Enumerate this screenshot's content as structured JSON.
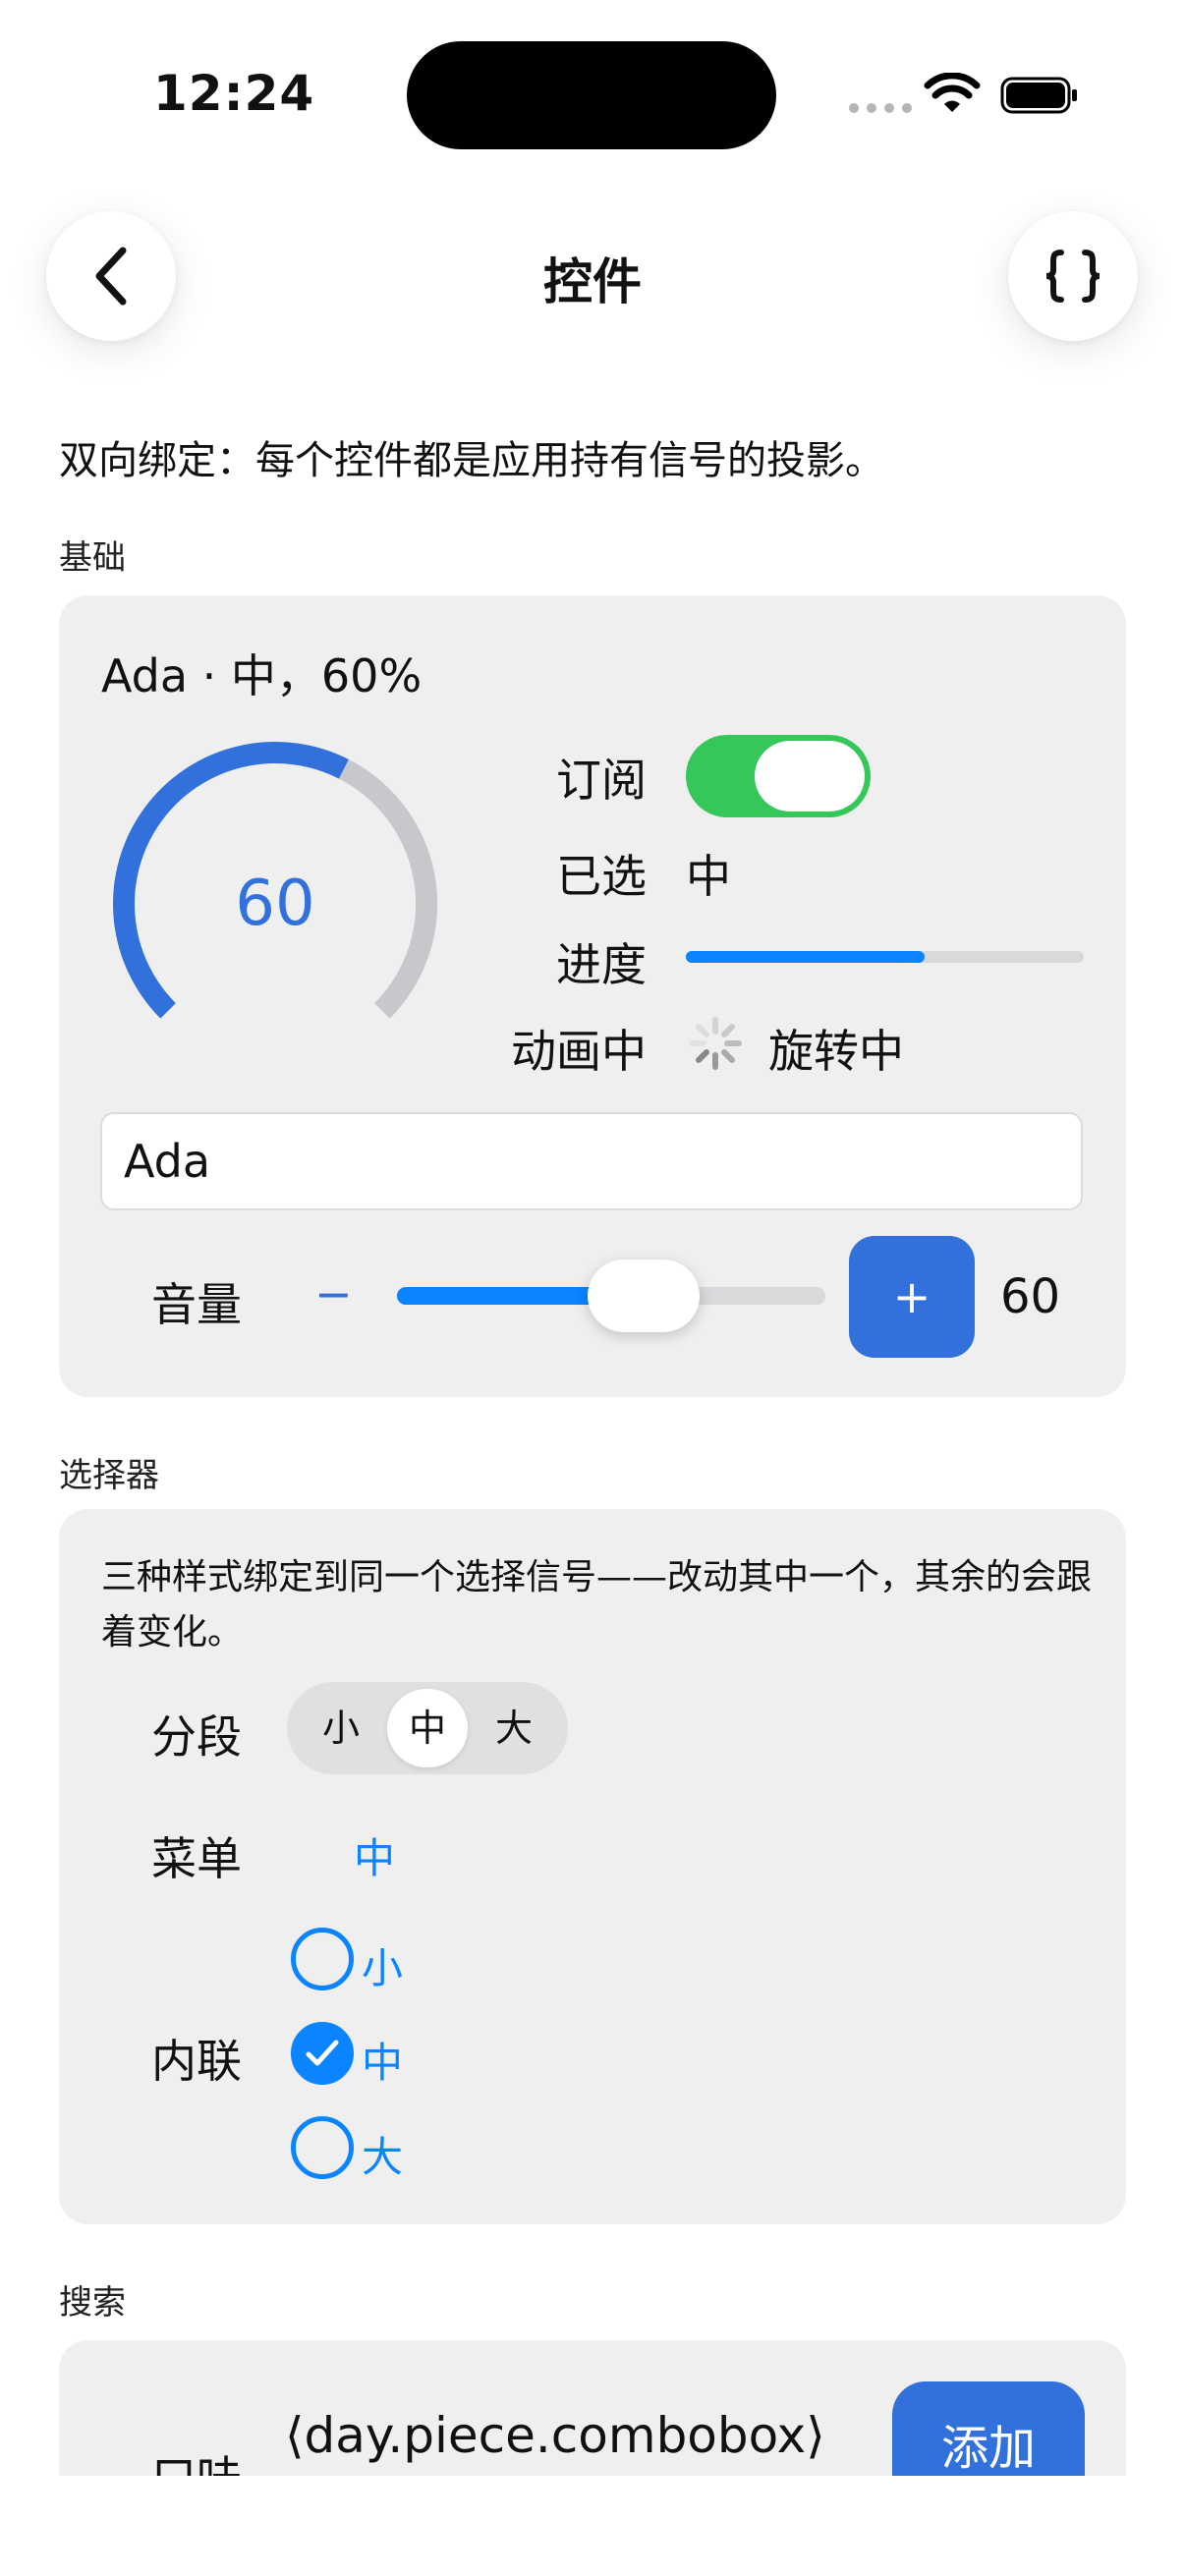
{
  "status_bar": {
    "time": "12:24"
  },
  "nav": {
    "title": "控件",
    "back_icon": "chevron-left-icon",
    "code_icon": "braces-icon"
  },
  "subtitle": "双向绑定：每个控件都是应用持有信号的投影。",
  "basics": {
    "section_label": "基础",
    "summary": "Ada · 中，60%",
    "gauge": {
      "value": 60,
      "min": 0,
      "max": 100,
      "display": "60"
    },
    "subscribe_label": "订阅",
    "subscribe_on": true,
    "selected_label": "已选",
    "selected_value": "中",
    "progress_label": "进度",
    "progress": 0.6,
    "animating_label": "动画中",
    "animating_value": "旋转中",
    "name_value": "Ada",
    "volume_label": "音量",
    "minus_label": "−",
    "plus_label": "+",
    "volume_value": "60",
    "volume_fraction": 0.6
  },
  "picker": {
    "section_label": "选择器",
    "description": "三种样式绑定到同一个选择信号——改动其中一个，其余的会跟着变化。",
    "segmented_label": "分段",
    "segments": [
      "小",
      "中",
      "大"
    ],
    "menu_label": "菜单",
    "menu_value": "中",
    "inline_label": "内联",
    "inline_options": [
      "小",
      "中",
      "大"
    ],
    "inline_selected": "中"
  },
  "search": {
    "section_label": "搜索",
    "row_label": "口味",
    "combobox_text": "⟨day.piece.combobox⟩",
    "add_label": "添加"
  },
  "colors": {
    "accent": "#3271db",
    "system_blue": "#0a84ff",
    "toggle_green": "#35c759",
    "card_bg": "#efefef"
  }
}
